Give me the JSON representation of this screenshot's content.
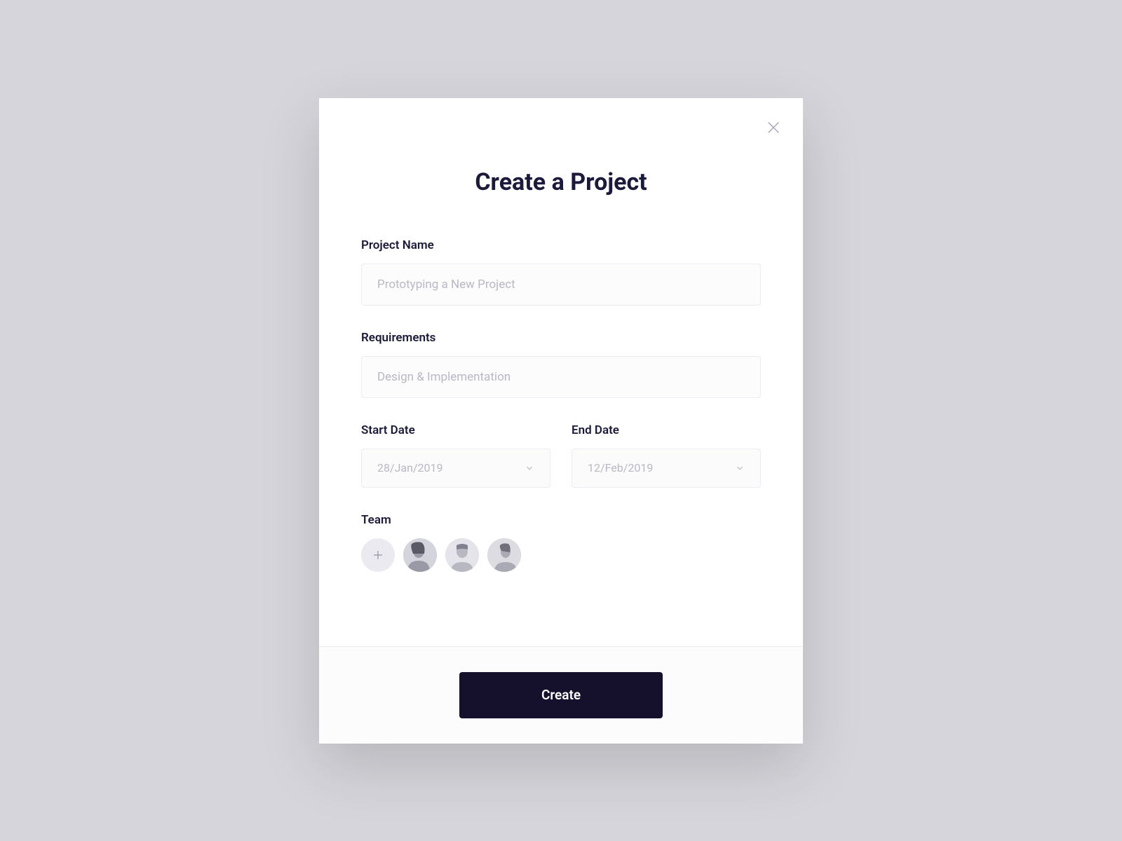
{
  "modal": {
    "title": "Create a Project",
    "close_icon": "close"
  },
  "fields": {
    "project_name": {
      "label": "Project Name",
      "placeholder": "Prototyping a New Project"
    },
    "requirements": {
      "label": "Requirements",
      "placeholder": "Design & Implementation"
    },
    "start_date": {
      "label": "Start Date",
      "value": "28/Jan/2019"
    },
    "end_date": {
      "label": "End Date",
      "value": "12/Feb/2019"
    },
    "team": {
      "label": "Team",
      "members": [
        {
          "id": "member-1"
        },
        {
          "id": "member-2"
        },
        {
          "id": "member-3"
        }
      ]
    }
  },
  "actions": {
    "create_label": "Create"
  }
}
